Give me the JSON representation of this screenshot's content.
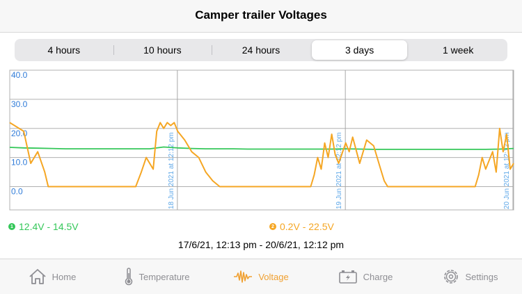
{
  "header": {
    "title": "Camper trailer Voltages"
  },
  "range_selector": {
    "options": [
      "4 hours",
      "10 hours",
      "24 hours",
      "3 days",
      "1 week"
    ],
    "selected": "3 days"
  },
  "chart_data": {
    "type": "line",
    "y_ticks": [
      "40.0",
      "30.0",
      "20.0",
      "10.0",
      "0.0"
    ],
    "ylim": [
      -8,
      40
    ],
    "x_markers": [
      "18 Jun 2021 at 12:12 pm",
      "19 Jun 2021 at 12:12 pm",
      "20 Jun 2021 at 12:12 pm"
    ],
    "grid": true,
    "series": [
      {
        "color": "#34c759",
        "x": [
          0,
          2,
          4,
          6,
          8,
          10,
          12,
          14,
          16,
          18,
          20,
          22,
          24,
          26,
          28,
          30,
          32,
          34,
          36,
          38,
          40,
          42,
          44,
          46,
          48,
          50,
          52,
          54,
          56,
          58,
          60,
          62,
          64,
          66,
          68,
          70,
          72
        ],
        "values": [
          13.5,
          13.3,
          13.2,
          13.1,
          13.0,
          13.0,
          13.0,
          13.0,
          13.0,
          13.0,
          13.0,
          13.6,
          13.3,
          13.1,
          13.0,
          13.0,
          13.0,
          12.9,
          12.9,
          12.9,
          12.9,
          12.9,
          12.9,
          12.9,
          13.0,
          12.9,
          12.8,
          12.8,
          12.8,
          12.8,
          12.8,
          12.8,
          12.8,
          12.8,
          12.8,
          12.9,
          13.1
        ]
      },
      {
        "color": "#f5a623",
        "x": [
          0,
          2,
          3,
          4,
          5,
          5.5,
          6,
          10,
          12,
          18,
          18.8,
          19.5,
          20.5,
          21,
          21.5,
          22,
          22.5,
          23,
          23.5,
          24,
          25,
          26,
          27,
          28,
          29,
          30,
          36,
          42,
          43,
          43.5,
          44,
          44.5,
          45,
          45.5,
          46,
          46.5,
          47,
          48,
          48.5,
          49,
          50,
          51,
          52,
          53,
          53.5,
          54,
          60,
          66,
          66.5,
          67,
          67.5,
          68,
          68.5,
          69,
          69.5,
          70,
          70.5,
          71,
          71.5,
          72
        ],
        "values": [
          22,
          19,
          8,
          12,
          5,
          0,
          0,
          0,
          0,
          0,
          5,
          10,
          6,
          19,
          22,
          20,
          22,
          21,
          22,
          19,
          16,
          12,
          10,
          5,
          2,
          0,
          0,
          0,
          0,
          4,
          10,
          6,
          15,
          10,
          18,
          11,
          8,
          15,
          12,
          17,
          8,
          16,
          14,
          6,
          2,
          0,
          0,
          0,
          0,
          4,
          10,
          6,
          9,
          12,
          5,
          20,
          12,
          18,
          6,
          8
        ]
      }
    ]
  },
  "legend": [
    {
      "badge": "1",
      "label": "12.4V - 14.5V",
      "color": "#34c759"
    },
    {
      "badge": "2",
      "label": "0.2V - 22.5V",
      "color": "#f5a623"
    }
  ],
  "date_range": "17/6/21, 12:13 pm - 20/6/21, 12:12 pm",
  "tabs": [
    {
      "label": "Home",
      "icon": "home-icon"
    },
    {
      "label": "Temperature",
      "icon": "thermometer-icon"
    },
    {
      "label": "Voltage",
      "icon": "voltage-wave-icon"
    },
    {
      "label": "Charge",
      "icon": "battery-icon"
    },
    {
      "label": "Settings",
      "icon": "gear-icon"
    }
  ]
}
